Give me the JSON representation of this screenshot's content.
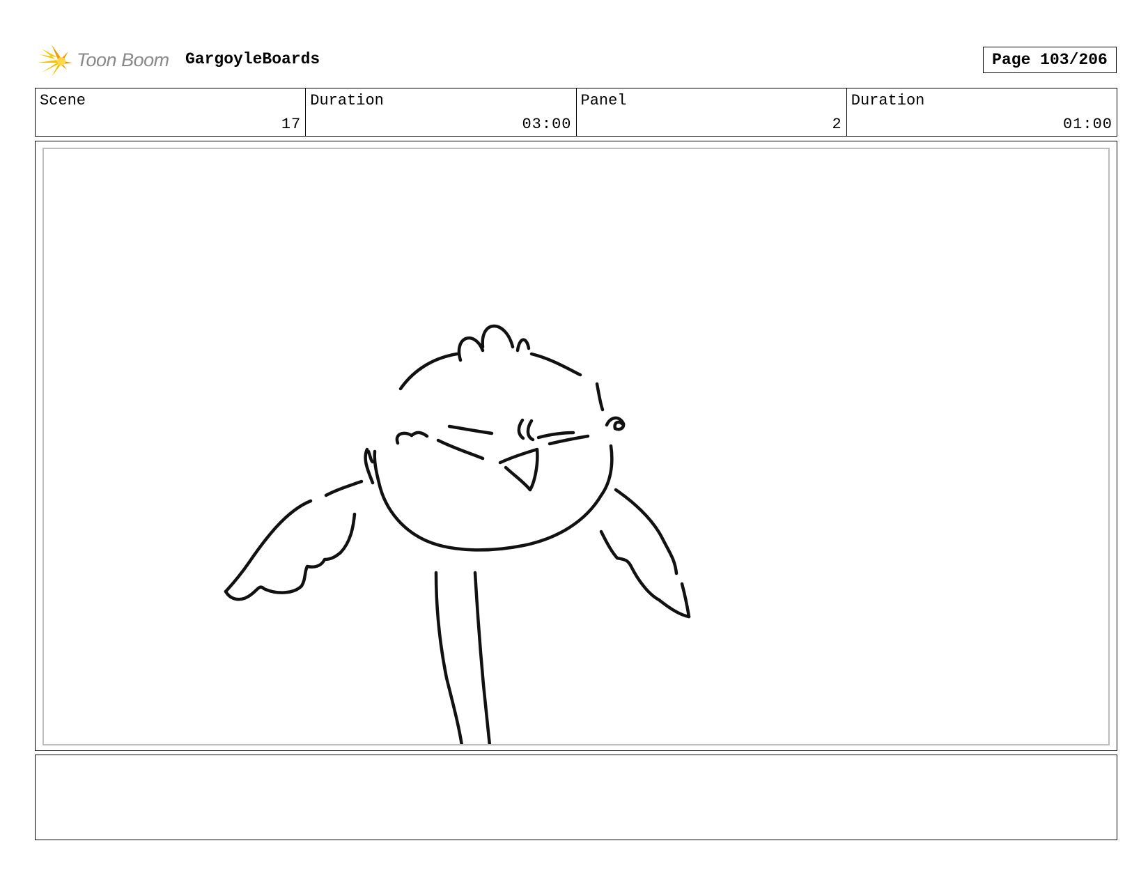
{
  "header": {
    "logo_text": "Toon Boom",
    "project_title": "GargoyleBoards",
    "page_label": "Page 103/206"
  },
  "info": {
    "scene_label": "Scene",
    "scene_value": "17",
    "scene_duration_label": "Duration",
    "scene_duration_value": "03:00",
    "panel_label": "Panel",
    "panel_value": "2",
    "panel_duration_label": "Duration",
    "panel_duration_value": "01:00"
  },
  "panel": {
    "drawing": "bird-sketch"
  },
  "notes": {
    "text": ""
  },
  "colors": {
    "logo_yellow": "#f5c400",
    "logo_orange": "#f29a00",
    "logo_text": "#8a8a8a",
    "frame_inner_border": "#bdbdbd"
  }
}
